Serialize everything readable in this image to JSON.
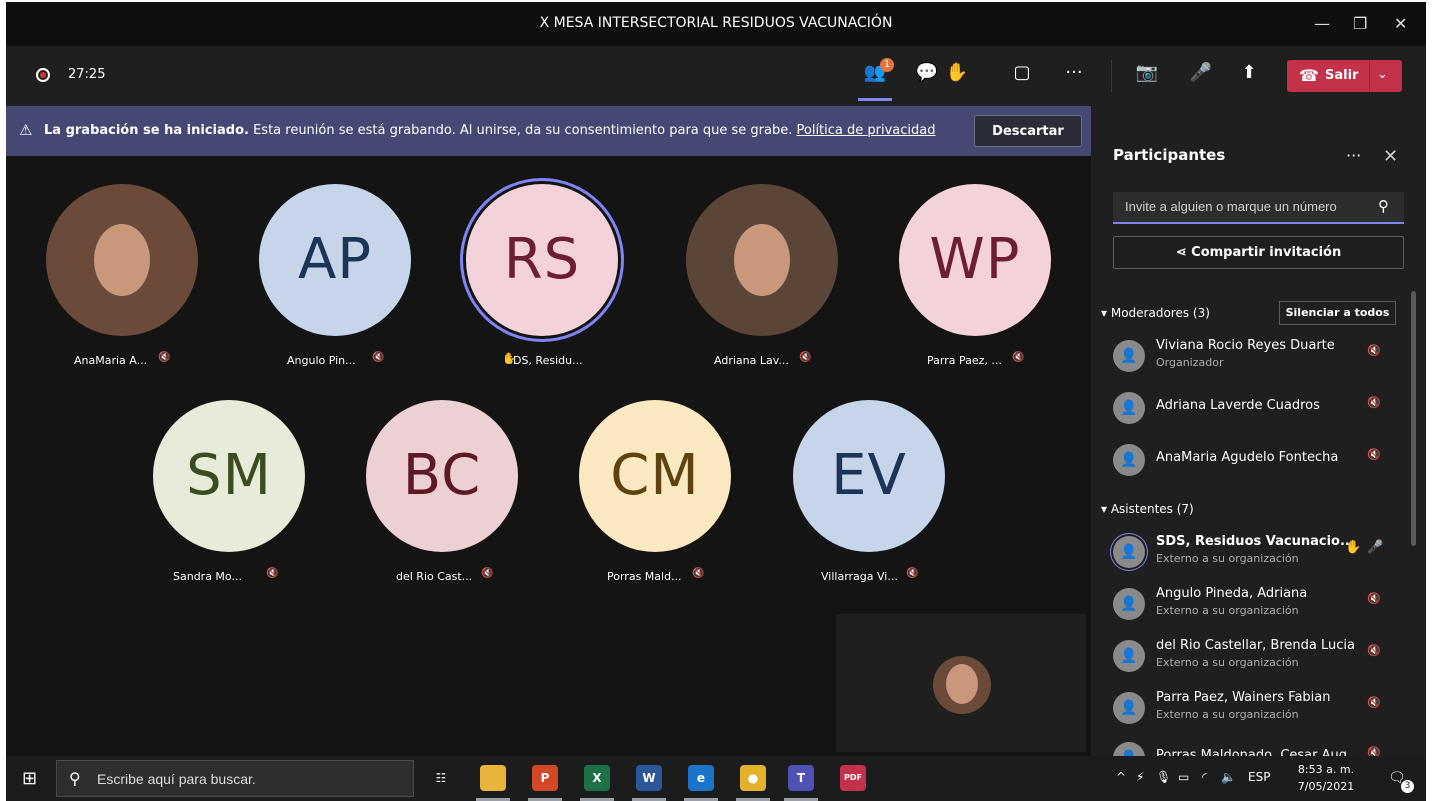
{
  "window": {
    "title": "X MESA INTERSECTORIAL RESIDUOS VACUNACIÓN",
    "minimize": "—",
    "maximize": "❐",
    "close": "✕"
  },
  "toolbar": {
    "timer": "27:25",
    "participants_badge": "1",
    "leave_label": "Salir",
    "icons": [
      "people-icon",
      "chat-icon",
      "raise-hand-icon",
      "rooms-icon",
      "more-icon",
      "camera-off-icon",
      "mic-off-icon",
      "share-screen-icon"
    ]
  },
  "banner": {
    "bold": "La grabación se ha iniciado.",
    "text": "Esta reunión se está grabando. Al unirse, da su consentimiento para que se grabe.",
    "link": "Política de privacidad",
    "dismiss": "Descartar"
  },
  "tiles": [
    {
      "name": "AnaMaria A...",
      "initials": "",
      "photo": true,
      "bg": "#6b4a3a",
      "fg": "#ffffff"
    },
    {
      "name": "Angulo Pin...",
      "initials": "AP",
      "photo": false,
      "bg": "#c7d5ea",
      "fg": "#1a3557"
    },
    {
      "name": "SDS, Residu...",
      "initials": "RS",
      "photo": false,
      "bg": "#f3d2da",
      "fg": "#6c1f33",
      "hand": true
    },
    {
      "name": "Adriana Lav...",
      "initials": "",
      "photo": true,
      "bg": "#5a4538",
      "fg": "#ffffff"
    },
    {
      "name": "Parra Paez, ...",
      "initials": "WP",
      "photo": false,
      "bg": "#f3d2da",
      "fg": "#6c1f33"
    },
    {
      "name": "Sandra Mo...",
      "initials": "SM",
      "photo": false,
      "bg": "#e6ecd9",
      "fg": "#3b4d1f"
    },
    {
      "name": "del Rio Cast...",
      "initials": "BC",
      "photo": false,
      "bg": "#ecd0d4",
      "fg": "#5e1a23"
    },
    {
      "name": "Porras Mald...",
      "initials": "CM",
      "photo": false,
      "bg": "#fbe9c2",
      "fg": "#5e4310"
    },
    {
      "name": "Villarraga Vi...",
      "initials": "EV",
      "photo": false,
      "bg": "#c7d5ea",
      "fg": "#1a3557"
    }
  ],
  "panel": {
    "title": "Participantes",
    "more": "···",
    "close": "✕",
    "search_placeholder": "Invite a alguien o marque un número",
    "share_label": "Compartir invitación",
    "moderators_header": "Moderadores (3)",
    "mute_all": "Silenciar a todos",
    "attendees_header": "Asistentes (7)",
    "moderators": [
      {
        "name": "Viviana Rocio Reyes Duarte",
        "role": "Organizador"
      },
      {
        "name": "Adriana Laverde Cuadros",
        "role": ""
      },
      {
        "name": "AnaMaria Agudelo Fontecha",
        "role": ""
      }
    ],
    "attendees": [
      {
        "name": "SDS, Residuos Vacunacio...",
        "role": "Externo a su organización",
        "hand": true
      },
      {
        "name": "Angulo Pineda, Adriana",
        "role": "Externo a su organización"
      },
      {
        "name": "del Rio Castellar, Brenda Lucia",
        "role": "Externo a su organización"
      },
      {
        "name": "Parra Paez, Wainers Fabian",
        "role": "Externo a su organización"
      },
      {
        "name": "Porras Maldonado, Cesar Aug...",
        "role": ""
      }
    ]
  },
  "taskbar": {
    "search_placeholder": "Escribe aquí para buscar.",
    "lang": "ESP",
    "time": "8:53 a. m.",
    "date": "7/05/2021",
    "notifications": "3",
    "apps": [
      "task-view-icon",
      "file-explorer-icon",
      "powerpoint-icon",
      "excel-icon",
      "word-icon",
      "edge-icon",
      "chrome-icon",
      "teams-icon",
      "pdf-icon"
    ]
  }
}
